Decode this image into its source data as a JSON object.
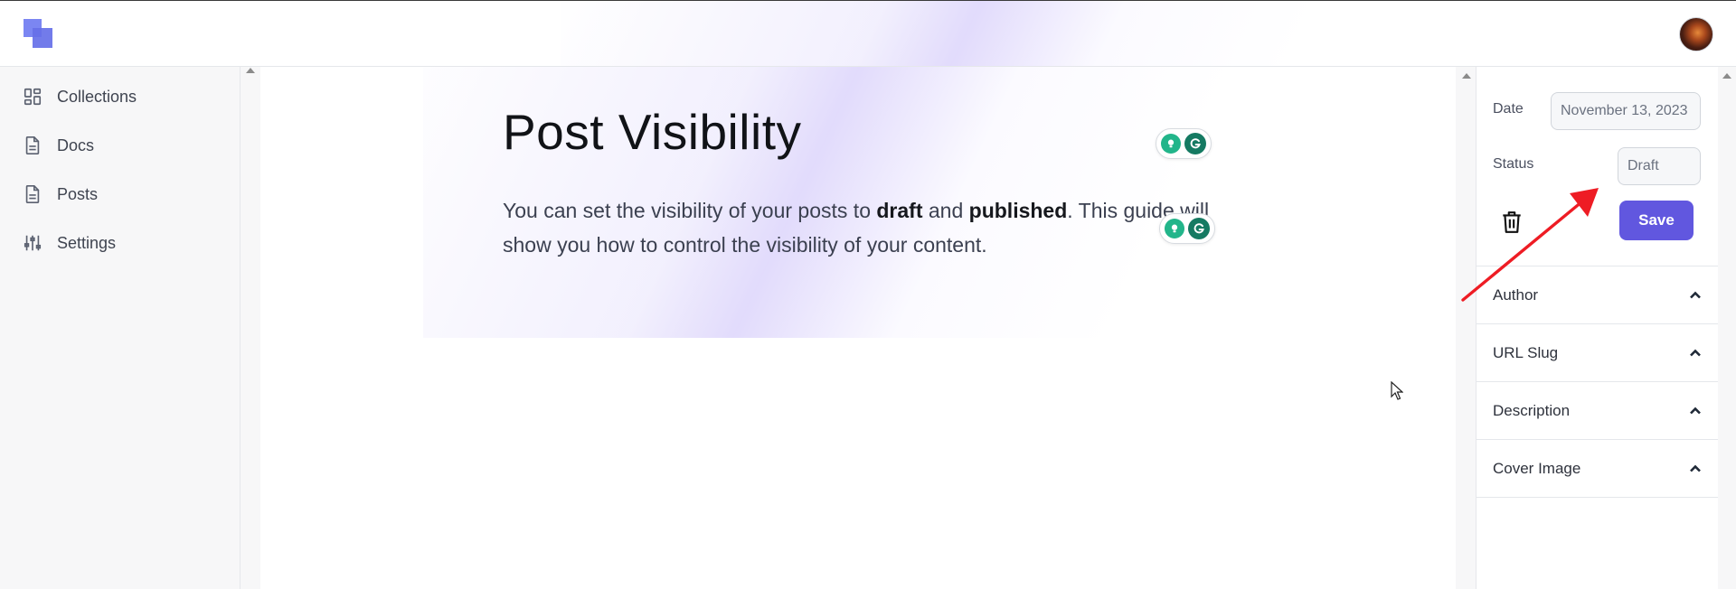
{
  "header": {
    "logo_icon": "logo-icon",
    "avatar_icon": "user-avatar"
  },
  "sidebar": {
    "items": [
      {
        "label": "Collections",
        "icon": "dashboard-icon"
      },
      {
        "label": "Docs",
        "icon": "document-icon"
      },
      {
        "label": "Posts",
        "icon": "document-icon"
      },
      {
        "label": "Settings",
        "icon": "sliders-icon"
      }
    ]
  },
  "editor": {
    "title": "Post Visibility",
    "body": {
      "part1": "You can set the visibility of your posts to ",
      "bold1": "draft",
      "part2": " and ",
      "bold2": "published",
      "part3": ". This guide will show you how to control the visibility of your content."
    }
  },
  "panel": {
    "date_label": "Date",
    "date_value": "November 13, 2023",
    "status_label": "Status",
    "status_value": "Draft",
    "save_label": "Save",
    "sections": [
      {
        "label": "Author"
      },
      {
        "label": "URL Slug"
      },
      {
        "label": "Description"
      },
      {
        "label": "Cover Image"
      }
    ]
  },
  "colors": {
    "accent": "#6157df",
    "logo": "#7b86f2",
    "grammarly": "#157a62",
    "annotation_arrow": "#ee1c24"
  }
}
